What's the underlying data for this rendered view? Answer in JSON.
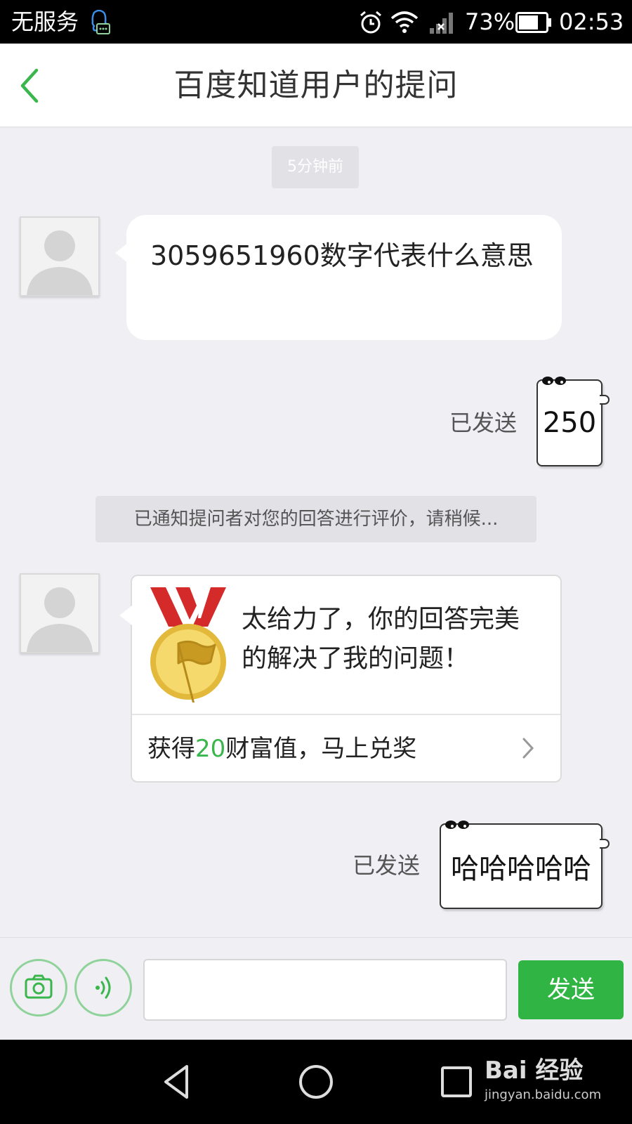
{
  "status_bar": {
    "carrier": "无服务",
    "battery_percent": "73%",
    "battery_level": 0.73,
    "time": "02:53"
  },
  "header": {
    "title": "百度知道用户的提问"
  },
  "chat": {
    "timestamp": "5分钟前",
    "question": "3059651960数字代表什么意思",
    "reply_1": {
      "status": "已发送",
      "text": "250"
    },
    "notice": "已通知提问者对您的回答进行评价，请稍候...",
    "award": {
      "message": "太给力了，你的回答完美的解决了我的问题！",
      "reward_prefix": "获得",
      "reward_amount": "20",
      "reward_suffix": "财富值，马上兑奖"
    },
    "reply_2": {
      "status": "已发送",
      "text": "哈哈哈哈哈"
    }
  },
  "input_bar": {
    "value": "",
    "send_label": "发送"
  },
  "colors": {
    "accent_green": "#30b545",
    "background": "#efeff4"
  },
  "watermark": {
    "brand": "Bai 经验",
    "url": "jingyan.baidu.com"
  }
}
